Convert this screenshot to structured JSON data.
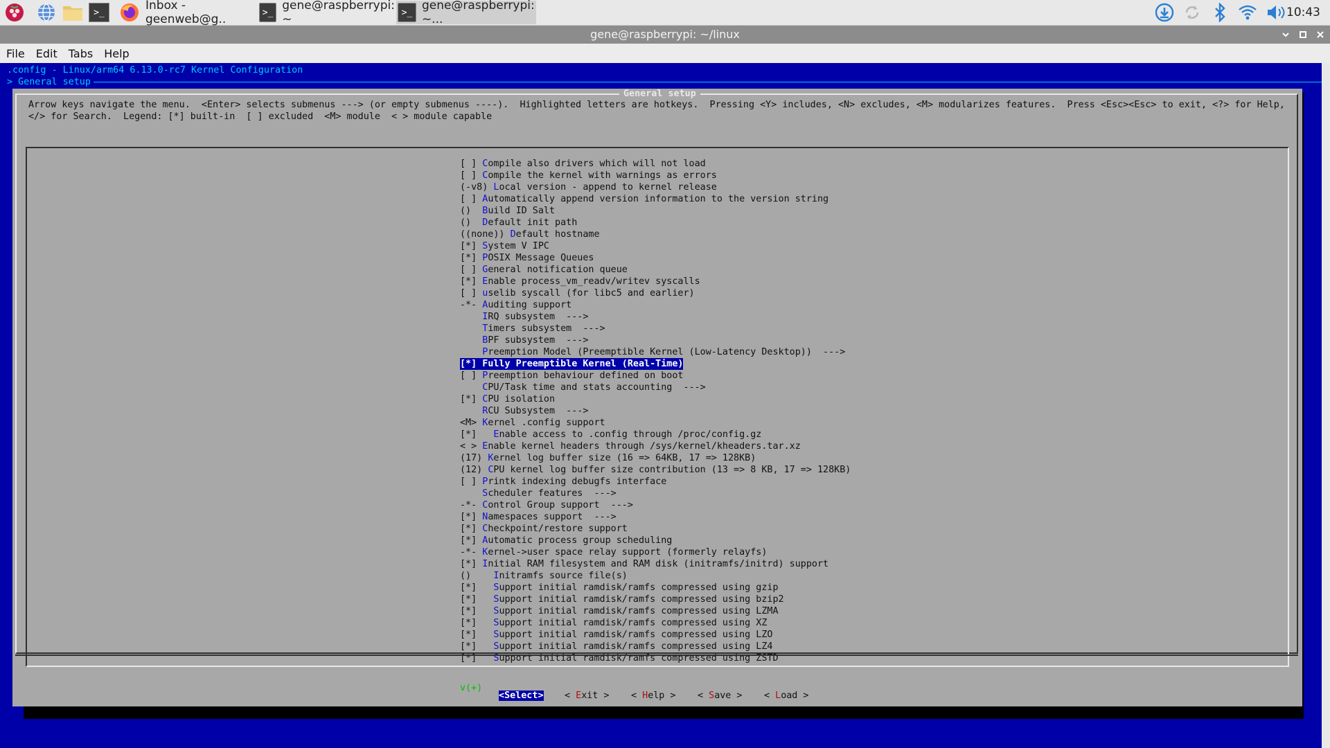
{
  "taskbar": {
    "tasks": [
      {
        "label": "Inbox - geenweb@g.."
      },
      {
        "label": "gene@raspberrypi: ~"
      },
      {
        "label": "gene@raspberrypi: ~..."
      }
    ],
    "clock": "10:43"
  },
  "window": {
    "title": "gene@raspberrypi: ~/linux",
    "menu": [
      "File",
      "Edit",
      "Tabs",
      "Help"
    ]
  },
  "terminal": {
    "header_line1": ".config - Linux/arm64 6.13.0-rc7 Kernel Configuration",
    "header_line2": "> General setup ",
    "dialog_title": "General setup",
    "help_line1": "Arrow keys navigate the menu.  <Enter> selects submenus ---> (or empty submenus ----).  Highlighted letters are hotkeys.  Pressing <Y> includes, <N> excludes, <M> modularizes features.  Press <Esc><Esc> to exit, <?> for Help,",
    "help_line2": "</> for Search.  Legend: [*] built-in  [ ] excluded  <M> module  < > module capable",
    "more_indicator": "v(+)",
    "rows": [
      {
        "prefix": "[ ] ",
        "hotkey": "C",
        "rest": "ompile also drivers which will not load"
      },
      {
        "prefix": "[ ] ",
        "hotkey": "C",
        "rest": "ompile the kernel with warnings as errors"
      },
      {
        "prefix": "(-v8) ",
        "hotkey": "L",
        "rest": "ocal version - append to kernel release"
      },
      {
        "prefix": "[ ] ",
        "hotkey": "A",
        "rest": "utomatically append version information to the version string"
      },
      {
        "prefix": "()  ",
        "hotkey": "B",
        "rest": "uild ID Salt"
      },
      {
        "prefix": "()  ",
        "hotkey": "D",
        "rest": "efault init path"
      },
      {
        "prefix": "((none)) ",
        "hotkey": "D",
        "rest": "efault hostname"
      },
      {
        "prefix": "[*] ",
        "hotkey": "S",
        "rest": "ystem V IPC"
      },
      {
        "prefix": "[*] ",
        "hotkey": "P",
        "rest": "OSIX Message Queues"
      },
      {
        "prefix": "[ ] ",
        "hotkey": "G",
        "rest": "eneral notification queue"
      },
      {
        "prefix": "[*] ",
        "hotkey": "E",
        "rest": "nable process_vm_readv/writev syscalls"
      },
      {
        "prefix": "[ ] ",
        "hotkey": "u",
        "rest": "selib syscall (for libc5 and earlier)"
      },
      {
        "prefix": "-*- ",
        "hotkey": "A",
        "rest": "uditing support"
      },
      {
        "prefix": "    ",
        "hotkey": "I",
        "rest": "RQ subsystem  --->"
      },
      {
        "prefix": "    ",
        "hotkey": "T",
        "rest": "imers subsystem  --->"
      },
      {
        "prefix": "    ",
        "hotkey": "B",
        "rest": "PF subsystem  --->"
      },
      {
        "prefix": "    ",
        "hotkey": "P",
        "rest": "reemption Model (Preemptible Kernel (Low-Latency Desktop))  --->"
      },
      {
        "prefix": "[*] ",
        "hotkey": "F",
        "rest": "ully Preemptible Kernel (Real-Time)"
      },
      {
        "prefix": "[ ] ",
        "hotkey": "P",
        "rest": "reemption behaviour defined on boot"
      },
      {
        "prefix": "    ",
        "hotkey": "C",
        "rest": "PU/Task time and stats accounting  --->"
      },
      {
        "prefix": "[*] ",
        "hotkey": "C",
        "rest": "PU isolation"
      },
      {
        "prefix": "    ",
        "hotkey": "R",
        "rest": "CU Subsystem  --->"
      },
      {
        "prefix": "<M> ",
        "hotkey": "K",
        "rest": "ernel .config support"
      },
      {
        "prefix": "[*]   ",
        "hotkey": "E",
        "rest": "nable access to .config through /proc/config.gz"
      },
      {
        "prefix": "< > ",
        "hotkey": "E",
        "rest": "nable kernel headers through /sys/kernel/kheaders.tar.xz"
      },
      {
        "prefix": "(17) ",
        "hotkey": "K",
        "rest": "ernel log buffer size (16 => 64KB, 17 => 128KB)"
      },
      {
        "prefix": "(12) ",
        "hotkey": "C",
        "rest": "PU kernel log buffer size contribution (13 => 8 KB, 17 => 128KB)"
      },
      {
        "prefix": "[ ] ",
        "hotkey": "P",
        "rest": "rintk indexing debugfs interface"
      },
      {
        "prefix": "    ",
        "hotkey": "S",
        "rest": "cheduler features  --->"
      },
      {
        "prefix": "-*- ",
        "hotkey": "C",
        "rest": "ontrol Group support  --->"
      },
      {
        "prefix": "[*] ",
        "hotkey": "N",
        "rest": "amespaces support  --->"
      },
      {
        "prefix": "[*] ",
        "hotkey": "C",
        "rest": "heckpoint/restore support"
      },
      {
        "prefix": "[*] ",
        "hotkey": "A",
        "rest": "utomatic process group scheduling"
      },
      {
        "prefix": "-*- ",
        "hotkey": "K",
        "rest": "ernel->user space relay support (formerly relayfs)"
      },
      {
        "prefix": "[*] ",
        "hotkey": "I",
        "rest": "nitial RAM filesystem and RAM disk (initramfs/initrd) support"
      },
      {
        "prefix": "()    ",
        "hotkey": "I",
        "rest": "nitramfs source file(s)"
      },
      {
        "prefix": "[*]   ",
        "hotkey": "S",
        "rest": "upport initial ramdisk/ramfs compressed using gzip"
      },
      {
        "prefix": "[*]   ",
        "hotkey": "S",
        "rest": "upport initial ramdisk/ramfs compressed using bzip2"
      },
      {
        "prefix": "[*]   ",
        "hotkey": "S",
        "rest": "upport initial ramdisk/ramfs compressed using LZMA"
      },
      {
        "prefix": "[*]   ",
        "hotkey": "S",
        "rest": "upport initial ramdisk/ramfs compressed using XZ"
      },
      {
        "prefix": "[*]   ",
        "hotkey": "S",
        "rest": "upport initial ramdisk/ramfs compressed using LZO"
      },
      {
        "prefix": "[*]   ",
        "hotkey": "S",
        "rest": "upport initial ramdisk/ramfs compressed using LZ4"
      },
      {
        "prefix": "[*]   ",
        "hotkey": "S",
        "rest": "upport initial ramdisk/ramfs compressed using ZSTD"
      }
    ],
    "selected_row": 17,
    "buttons": [
      {
        "left": "<",
        "hotkey": "S",
        "rest": "elect",
        "right": ">",
        "selected": true
      },
      {
        "left": "< ",
        "hotkey": "E",
        "rest": "xit",
        "right": " >",
        "selected": false
      },
      {
        "left": "< ",
        "hotkey": "H",
        "rest": "elp",
        "right": " >",
        "selected": false
      },
      {
        "left": "< ",
        "hotkey": "S",
        "rest": "ave",
        "right": " >",
        "selected": false
      },
      {
        "left": "< ",
        "hotkey": "L",
        "rest": "oad",
        "right": " >",
        "selected": false
      }
    ]
  },
  "icons": [
    "raspberry-menu-icon",
    "web-browser-icon",
    "file-manager-icon",
    "terminal-icon",
    "firefox-icon",
    "download-update-icon",
    "sync-icon",
    "bluetooth-icon",
    "wifi-icon",
    "volume-icon",
    "minimize-icon",
    "maximize-icon",
    "close-icon"
  ],
  "colors": {
    "terminal_bg": "#0000a8",
    "dialog_bg": "#a8a8a8",
    "hotkey": "#1010d0",
    "button_hotkey": "#b01010",
    "header_text": "#00c8ff"
  }
}
